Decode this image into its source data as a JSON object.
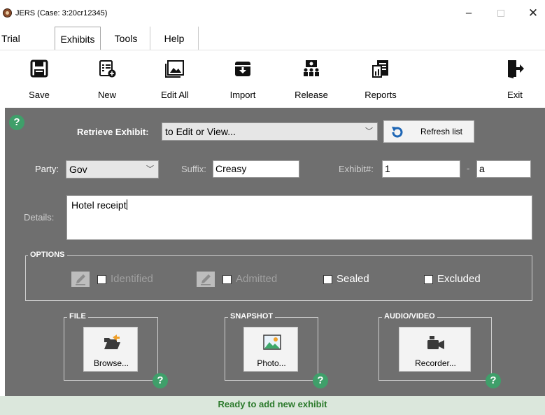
{
  "window": {
    "title": "JERS (Case: 3:20cr12345)",
    "minimize_glyph": "–",
    "close_glyph": "✕"
  },
  "menu": {
    "tabs": [
      {
        "label": "Trial"
      },
      {
        "label": "Exhibits",
        "active": true
      },
      {
        "label": "Tools"
      },
      {
        "label": "Help"
      }
    ]
  },
  "toolbar": {
    "save": "Save",
    "new": "New",
    "edit_all": "Edit All",
    "import": "Import",
    "release": "Release",
    "reports": "Reports",
    "exit": "Exit"
  },
  "retrieve": {
    "label": "Retrieve Exhibit:",
    "selected": "to Edit or View...",
    "refresh": "Refresh list"
  },
  "form": {
    "party_label": "Party:",
    "party_value": "Gov",
    "suffix_label": "Suffix:",
    "suffix_value": "Creasy",
    "exhibit_label": "Exhibit#:",
    "exhibit_value": "1",
    "dash": "-",
    "exhibit_sub_value": "a",
    "details_label": "Details:",
    "details_value": "Hotel receipt"
  },
  "options": {
    "title": "OPTIONS",
    "identified": "Identified",
    "admitted": "Admitted",
    "sealed": "Sealed",
    "excluded": "Excluded"
  },
  "file": {
    "title": "FILE",
    "button": "Browse..."
  },
  "snapshot": {
    "title": "SNAPSHOT",
    "button": "Photo..."
  },
  "audio_video": {
    "title": "AUDIO/VIDEO",
    "button": "Recorder..."
  },
  "help_glyph": "?",
  "status": {
    "text": "Ready to add new exhibit"
  },
  "colors": {
    "panel": "#6f6f6f",
    "help": "#3f9f6a",
    "status_text": "#2c7a2c",
    "status_bg": "#dbe7dc"
  }
}
